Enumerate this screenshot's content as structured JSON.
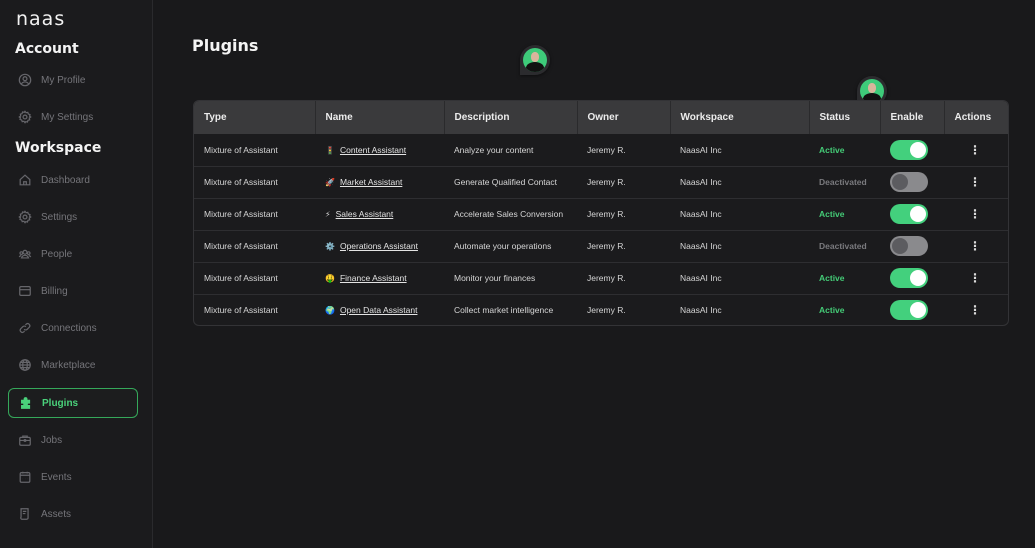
{
  "app": {
    "logo": "naas"
  },
  "sidebar": {
    "account_title": "Account",
    "account_items": [
      {
        "label": "My Profile",
        "icon": "user-circle-icon"
      },
      {
        "label": "My Settings",
        "icon": "gear-icon"
      }
    ],
    "workspace_title": "Workspace",
    "workspace_items": [
      {
        "label": "Dashboard",
        "icon": "home-icon"
      },
      {
        "label": "Settings",
        "icon": "gear-icon"
      },
      {
        "label": "People",
        "icon": "people-icon"
      },
      {
        "label": "Billing",
        "icon": "card-icon"
      },
      {
        "label": "Connections",
        "icon": "link-icon"
      },
      {
        "label": "Marketplace",
        "icon": "globe-icon"
      },
      {
        "label": "Plugins",
        "icon": "puzzle-icon",
        "active": true
      },
      {
        "label": "Jobs",
        "icon": "briefcase-icon"
      },
      {
        "label": "Events",
        "icon": "calendar-icon"
      },
      {
        "label": "Assets",
        "icon": "document-icon"
      }
    ]
  },
  "main": {
    "title": "Plugins",
    "accent_color": "#43d07d",
    "table": {
      "headers": [
        "Type",
        "Name",
        "Description",
        "Owner",
        "Workspace",
        "Status",
        "Enable",
        "Actions"
      ],
      "rows": [
        {
          "type": "Mixture of Assistant",
          "emoji": "🚦",
          "name": "Content Assistant",
          "description": "Analyze your content",
          "owner": "Jeremy R.",
          "workspace": "NaasAI Inc",
          "status": "Active",
          "enabled": true
        },
        {
          "type": "Mixture of Assistant",
          "emoji": "🚀",
          "name": "Market Assistant",
          "description": "Generate Qualified Contact",
          "owner": "Jeremy R.",
          "workspace": "NaasAI Inc",
          "status": "Deactivated",
          "enabled": false
        },
        {
          "type": "Mixture of Assistant",
          "emoji": "⚡",
          "name": "Sales Assistant",
          "description": "Accelerate Sales Conversion",
          "owner": "Jeremy R.",
          "workspace": "NaasAI Inc",
          "status": "Active",
          "enabled": true
        },
        {
          "type": "Mixture of Assistant",
          "emoji": "⚙️",
          "name": "Operations Assistant",
          "description": "Automate your operations",
          "owner": "Jeremy R.",
          "workspace": "NaasAI Inc",
          "status": "Deactivated",
          "enabled": false
        },
        {
          "type": "Mixture of Assistant",
          "emoji": "🤑",
          "name": "Finance Assistant",
          "description": "Monitor your finances",
          "owner": "Jeremy R.",
          "workspace": "NaasAI Inc",
          "status": "Active",
          "enabled": true
        },
        {
          "type": "Mixture of Assistant",
          "emoji": "🌍",
          "name": "Open Data Assistant",
          "description": "Collect market intelligence",
          "owner": "Jeremy R.",
          "workspace": "NaasAI Inc",
          "status": "Active",
          "enabled": true
        }
      ],
      "actions_glyph": "⋮"
    }
  }
}
